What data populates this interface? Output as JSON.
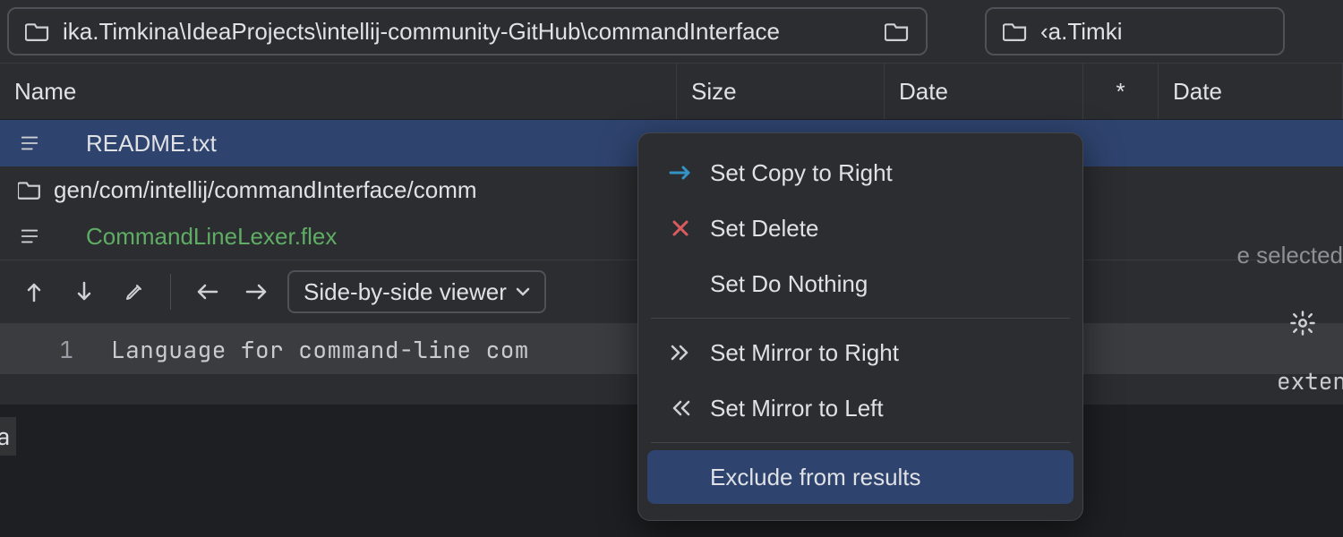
{
  "path": {
    "left": "ika.Timkina\\IdeaProjects\\intellij-community-GitHub\\commandInterface",
    "right": "‹a.Timki"
  },
  "columns": {
    "name": "Name",
    "size": "Size",
    "date": "Date",
    "star": "*",
    "date2": "Date"
  },
  "rows": [
    {
      "icon": "file",
      "name": "README.txt",
      "selected": true,
      "indented": true,
      "color": "default"
    },
    {
      "icon": "folder",
      "name": "gen/com/intellij/commandInterface/comm",
      "selected": false,
      "indented": false,
      "color": "default"
    },
    {
      "icon": "file",
      "name": "CommandLineLexer.flex",
      "selected": false,
      "indented": true,
      "color": "green"
    }
  ],
  "placeholder_right": "e selected",
  "toolbar": {
    "viewer_label": "Side-by-side viewer"
  },
  "code": {
    "line_number": "1",
    "text": "Language for command-line com"
  },
  "right_code_stub": "exten",
  "left_stub": "a",
  "menu": {
    "items": [
      {
        "icon": "arrow-right-blue",
        "label": "Set Copy to Right"
      },
      {
        "icon": "cross-red",
        "label": "Set Delete"
      },
      {
        "icon": "none",
        "label": "Set Do Nothing"
      }
    ],
    "items2": [
      {
        "icon": "chevrons-right",
        "label": "Set Mirror to Right"
      },
      {
        "icon": "chevrons-left",
        "label": "Set Mirror to Left"
      }
    ],
    "items3": [
      {
        "icon": "none",
        "label": "Exclude from results",
        "highlight": true
      }
    ]
  }
}
